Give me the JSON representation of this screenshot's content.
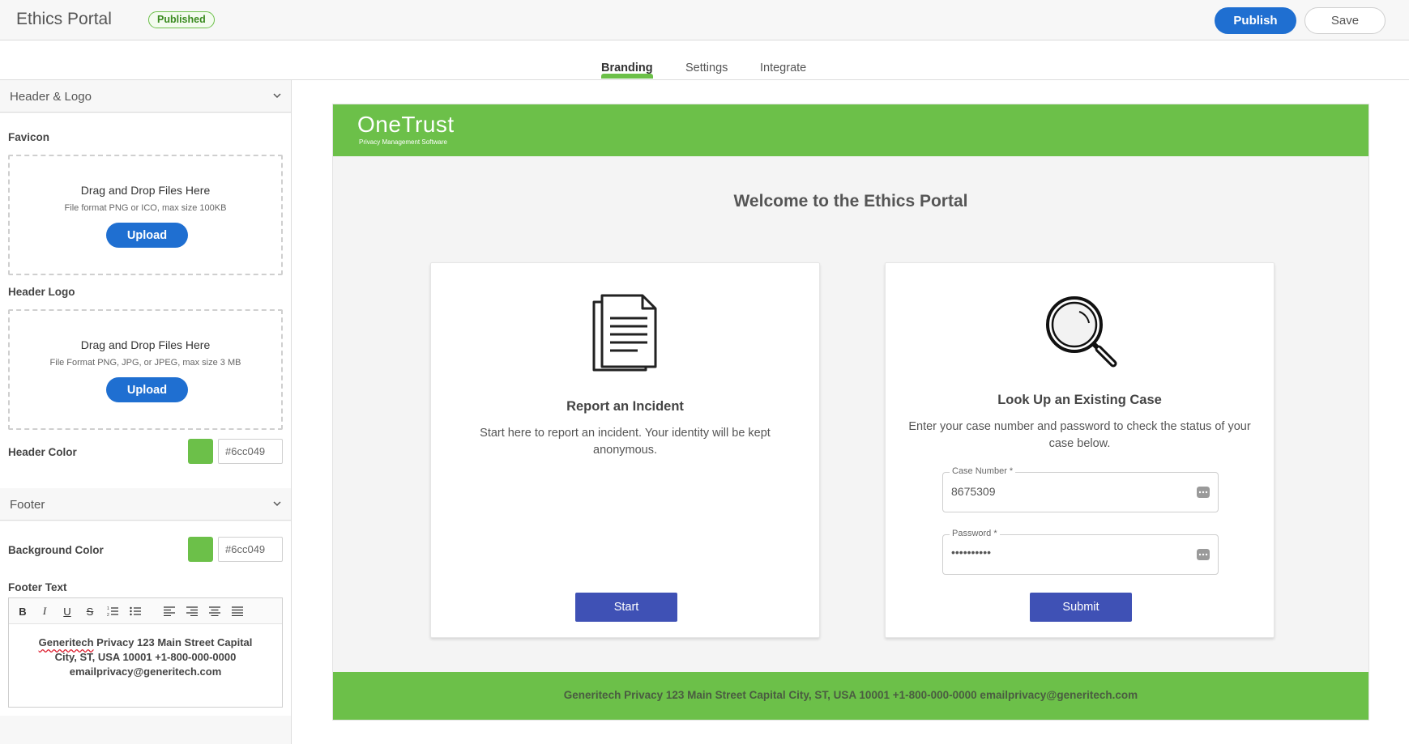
{
  "app": {
    "title": "Ethics Portal",
    "status": "Published",
    "publish_label": "Publish",
    "save_label": "Save"
  },
  "tabs": [
    {
      "label": "Branding",
      "active": true
    },
    {
      "label": "Settings"
    },
    {
      "label": "Integrate"
    }
  ],
  "sidebar": {
    "header_section": {
      "title": "Header & Logo",
      "favicon": {
        "label": "Favicon",
        "drop_title": "Drag and Drop Files Here",
        "drop_sub": "File format PNG or ICO, max size 100KB",
        "upload_label": "Upload"
      },
      "header_logo": {
        "label": "Header Logo",
        "drop_title": "Drag and Drop Files Here",
        "drop_sub": "File Format PNG, JPG, or JPEG, max size 3 MB",
        "upload_label": "Upload"
      },
      "header_color": {
        "label": "Header Color",
        "value": "#6cc049"
      }
    },
    "footer_section": {
      "title": "Footer",
      "background_color": {
        "label": "Background Color",
        "value": "#6cc049"
      },
      "footer_text": {
        "label": "Footer Text",
        "toolbar": [
          "bold-icon",
          "italic-icon",
          "underline-icon",
          "strikethrough-icon",
          "ordered-list-icon",
          "bullet-list-icon",
          "align-left-icon",
          "align-right-icon",
          "align-center-icon",
          "align-justify-icon"
        ],
        "content_word1": "Generitech",
        "content_rest1": " Privacy 123 Main Street Capital",
        "content_line2": "City, ST, USA 10001 +1-800-000-0000",
        "content_line3": "emailprivacy@generitech.com"
      }
    }
  },
  "preview": {
    "header_color": "#6cc049",
    "logo_text": "OneTrust",
    "logo_sub": "Privacy Management Software",
    "welcome": "Welcome to the Ethics Portal",
    "report_card": {
      "icon": "document-icon",
      "title": "Report an Incident",
      "description": "Start here to report an incident. Your identity will be kept anonymous.",
      "button": "Start"
    },
    "lookup_card": {
      "icon": "magnifier-icon",
      "title": "Look Up an Existing Case",
      "description": "Enter your case number and password to check the status of your case below.",
      "case_number_label": "Case Number *",
      "case_number_value": "8675309",
      "password_label": "Password *",
      "password_value": "••••••••••",
      "button": "Submit"
    },
    "footer_text": "Generitech Privacy 123 Main Street Capital City, ST, USA 10001 +1-800-000-0000 emailprivacy@generitech.com"
  }
}
